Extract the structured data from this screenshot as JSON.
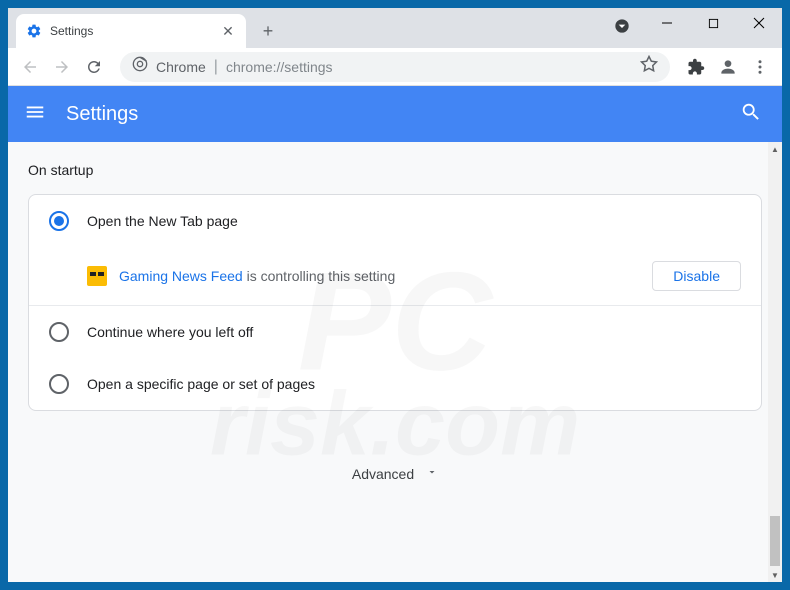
{
  "tab": {
    "title": "Settings"
  },
  "address": {
    "label": "Chrome",
    "url": "chrome://settings"
  },
  "header": {
    "title": "Settings"
  },
  "section": {
    "title": "On startup"
  },
  "options": {
    "new_tab": "Open the New Tab page",
    "continue": "Continue where you left off",
    "specific": "Open a specific page or set of pages"
  },
  "controlled": {
    "extension_name": "Gaming News Feed",
    "suffix": " is controlling this setting",
    "disable_label": "Disable"
  },
  "advanced": {
    "label": "Advanced"
  },
  "watermark": {
    "line1": "PC",
    "line2": "risk.com"
  }
}
